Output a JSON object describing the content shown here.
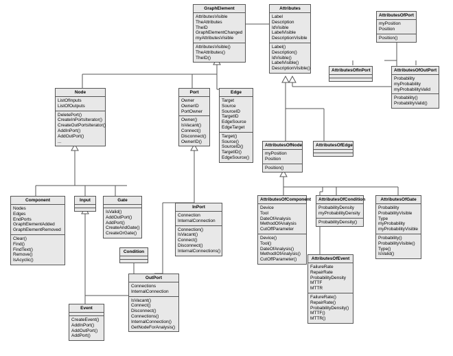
{
  "classes": {
    "GraphElement": {
      "title": "GraphElement",
      "attrs": [
        "AttributesVisible",
        "TheAttributes",
        "TheID",
        "GraphElementChanged",
        "myAttributesVisible"
      ],
      "ops": [
        "AttributesVisible()",
        "TheAttributes()",
        "TheID()"
      ]
    },
    "Attributes": {
      "title": "Attributes",
      "attrs": [
        "Label",
        "Description",
        "IdVisible",
        "LabelVisible",
        "DescriptionVisible"
      ],
      "ops": [
        "Label()",
        "Description()",
        "IdVisible()",
        "LabelVisible()",
        "DescriptionVisible()"
      ]
    },
    "AttributesOfPort": {
      "title": "AttributesOfPort",
      "attrs": [
        "myPosition",
        "Position"
      ],
      "ops": [
        "Position()"
      ]
    },
    "AttributesOfInPort": {
      "title": "AttributesOfInPort",
      "attrs": [],
      "ops": []
    },
    "AttributesOfOutPort": {
      "title": "AttributesOfOutPort",
      "attrs": [
        "Probability",
        "myProbability",
        "myProbabilityValid"
      ],
      "ops": [
        "Probability()",
        "ProbabilityValid()"
      ]
    },
    "Node": {
      "title": "Node",
      "attrs": [
        "ListOfInputs",
        "ListOfOutputs"
      ],
      "ops": [
        "DeletePort()",
        "CreateInPortsIterator()",
        "CreateOutPortsIterator()",
        "AddInPort()",
        "AddOutPort()",
        "..."
      ]
    },
    "Port": {
      "title": "Port",
      "attrs": [
        "Owner",
        "OwnerID",
        "PortOwner"
      ],
      "ops": [
        "Owner()",
        "IsVacant()",
        "Connect()",
        "Disconnect()",
        "OwnerID()"
      ]
    },
    "Edge": {
      "title": "Edge",
      "attrs": [
        "Target",
        "Source",
        "SourceID",
        "TargetID",
        "EdgeSource",
        "EdgeTarget"
      ],
      "ops": [
        "Target()",
        "Source()",
        "SourceID()",
        "TargetID()",
        "EdgeSource()"
      ]
    },
    "AttributesOfNode": {
      "title": "AttributesOfNode",
      "attrs": [
        "myPosition",
        "Position"
      ],
      "ops": [
        "Position()"
      ]
    },
    "AttributesOfEdge": {
      "title": "AttributesOfEdge",
      "attrs": [],
      "ops": []
    },
    "Component": {
      "title": "Component",
      "attrs": [
        "Nodes",
        "Edges",
        "EndPorts",
        "GraphElementAdded",
        "GraphElementRemoved"
      ],
      "ops": [
        "Clear()",
        "Find()",
        "FindText()",
        "Remove()",
        "IsAcyclic()"
      ]
    },
    "Input": {
      "title": "Input",
      "attrs": [],
      "ops": []
    },
    "Gate": {
      "title": "Gate",
      "attrs": [],
      "ops": [
        "IsValid()",
        "AddOutPort()",
        "AddPort()",
        "CreateAndGate()",
        "CreateOrGate()"
      ]
    },
    "Condition": {
      "title": "Condition",
      "attrs": [],
      "ops": []
    },
    "Event": {
      "title": "Event",
      "attrs": [],
      "ops": [
        "CreateEvent()",
        "AddInPort()",
        "AddOutPort()",
        "AddPort()"
      ]
    },
    "InPort": {
      "title": "InPort",
      "attrs": [
        "Connection",
        "InternalConnection"
      ],
      "ops": [
        "Connection()",
        "IsVacant()",
        "Connect()",
        "Disconnect()",
        "InternalConnections()"
      ]
    },
    "OutPort": {
      "title": "OutPort",
      "attrs": [
        "Connections",
        "InternalConnection"
      ],
      "ops": [
        "IsVacant()",
        "Connect()",
        "Disconnect()",
        "Connections()",
        "InternalConnection()",
        "GetNodeForAnalysis()"
      ]
    },
    "AttributesOfComponent": {
      "title": "AttributesOfComponent",
      "attrs": [
        "Device",
        "Tool",
        "DateOfAnalysis",
        "MethodOfAnalysis",
        "CutOffParameter"
      ],
      "ops": [
        "Device()",
        "Tool()",
        "DateOfAnalysis()",
        "MethodIOfAnalysis()",
        "CutOffParameter()"
      ]
    },
    "AttributesOfCondition": {
      "title": "AttributesOfCondition",
      "attrs": [
        "ProbabilityDensity",
        "myProbabilityDensity"
      ],
      "ops": [
        "ProbabilityDensity()"
      ]
    },
    "AttributesOfGate": {
      "title": "AttributesOfGate",
      "attrs": [
        "Probability",
        "ProbabilityVisible",
        "Type",
        "myProbability",
        "myProbabilityVisible"
      ],
      "ops": [
        "Probability()",
        "ProbabilityVisible()",
        "Type()",
        "IsValid()"
      ]
    },
    "AttributesOfEvent": {
      "title": "AttributesOfEvent",
      "attrs": [
        "FailureRate",
        "RepairRate",
        "ProbabilityDensity",
        "MTTF",
        "MTTR"
      ],
      "ops": [
        "FailureRate()",
        "RepairRate()",
        "ProbabilityDensity()",
        "MTTF()",
        "MTTR()"
      ]
    }
  }
}
